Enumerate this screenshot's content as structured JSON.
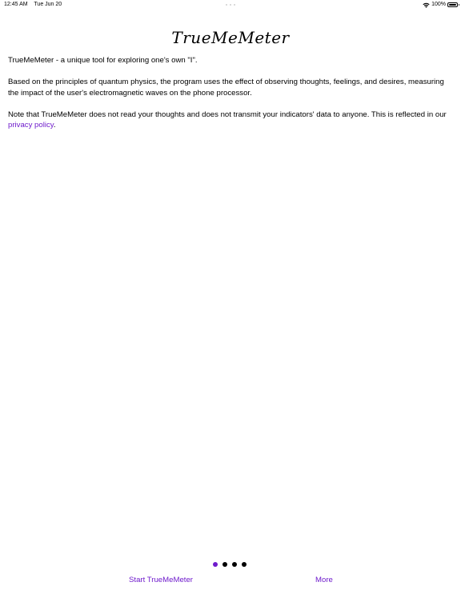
{
  "status_bar": {
    "time": "12:45 AM",
    "date": "Tue Jun 20",
    "battery": "100%"
  },
  "app": {
    "title": "TrueMeMeter"
  },
  "content": {
    "intro": "TrueMeMeter - a unique tool for exploring one's own \"I\".",
    "principles": "Based on the principles of quantum physics, the program uses the effect of observing thoughts, feelings, and desires, measuring the impact of the user's electromagnetic waves on the phone processor.",
    "privacy_prefix": "Note that TrueMeMeter does not read your thoughts and does not transmit your indicators' data to anyone. This is reflected in our ",
    "privacy_link": "privacy policy",
    "privacy_suffix": "."
  },
  "pager": {
    "total": 4,
    "current": 1
  },
  "buttons": {
    "start": "Start TrueMeMeter",
    "more": "More"
  },
  "colors": {
    "accent": "#6f1bcc",
    "text": "#000000",
    "background": "#ffffff"
  }
}
